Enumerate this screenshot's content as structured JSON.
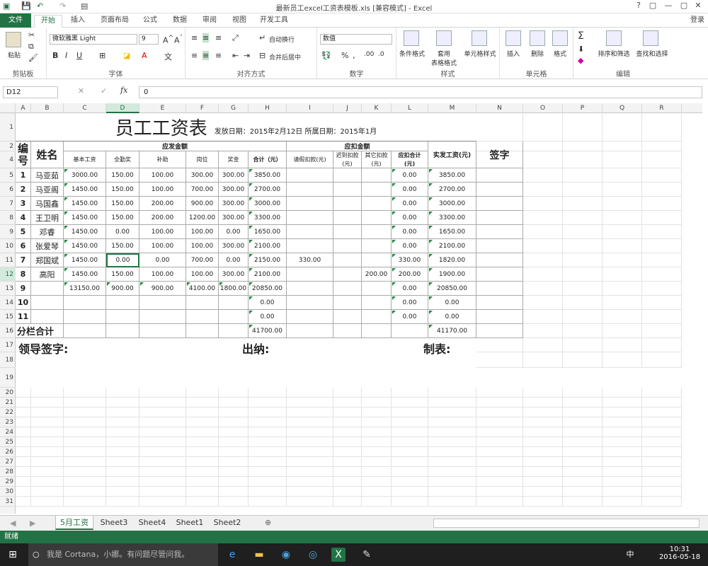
{
  "window": {
    "title": "最新员工excel工资表模板.xls  [兼容模式] - Excel",
    "controls": [
      "?",
      "▢",
      "—",
      "▢",
      "✕"
    ],
    "login": "登录"
  },
  "tabs": [
    "文件",
    "开始",
    "插入",
    "页面布局",
    "公式",
    "数据",
    "审阅",
    "视图",
    "开发工具"
  ],
  "ribbon": {
    "clipboard": {
      "paste": "粘贴",
      "label": "剪贴板"
    },
    "font": {
      "name": "微软雅黑 Light",
      "size": "9",
      "label": "字体",
      "bold": "B",
      "italic": "I",
      "underline": "U"
    },
    "align": {
      "wrap": "自动换行",
      "merge": "合并后居中",
      "label": "对齐方式"
    },
    "number": {
      "format": "数值",
      "label": "数字"
    },
    "styles": {
      "cond": "条件格式",
      "table": "套用\n表格格式",
      "cell": "单元格样式",
      "label": "样式"
    },
    "cells": {
      "insert": "插入",
      "delete": "删除",
      "format": "格式",
      "label": "单元格"
    },
    "edit": {
      "sort": "排序和筛选",
      "find": "查找和选择",
      "label": "编辑"
    }
  },
  "formula": {
    "namebox": "D12",
    "fx": "fx",
    "value": "0"
  },
  "columns": [
    "A",
    "B",
    "C",
    "D",
    "E",
    "F",
    "G",
    "H",
    "I",
    "J",
    "K",
    "L",
    "M",
    "N",
    "O",
    "P",
    "Q",
    "R"
  ],
  "rows": [
    "1",
    "2",
    "4",
    "5",
    "6",
    "7",
    "8",
    "9",
    "10",
    "11",
    "12",
    "13",
    "14",
    "15",
    "16",
    "17",
    "18",
    "19",
    "20",
    "21",
    "22",
    "23",
    "24",
    "25",
    "26",
    "27",
    "28",
    "29",
    "30",
    "31"
  ],
  "sheet": {
    "title": "员工工资表",
    "subtitle": "发放日期：2015年2月12日 所属日期：2015年1月",
    "h_num": "编号",
    "h_name": "姓名",
    "h_pay": "应发金额",
    "h_ded": "应扣金额",
    "h_net": "实发工资(元)",
    "h_sign": "签字",
    "sub": [
      "基本工资",
      "全勤奖",
      "补助",
      "岗位",
      "奖金",
      "合计（元）",
      "请假扣款(元)",
      "迟到扣款(元)",
      "其它扣款(元)",
      "应扣合计(元)"
    ],
    "data": [
      [
        "1",
        "马亚茹",
        "3000.00",
        "150.00",
        "100.00",
        "300.00",
        "300.00",
        "3850.00",
        "",
        "",
        "",
        "0.00",
        "3850.00"
      ],
      [
        "2",
        "马亚阁",
        "1450.00",
        "150.00",
        "100.00",
        "700.00",
        "300.00",
        "2700.00",
        "",
        "",
        "",
        "0.00",
        "2700.00"
      ],
      [
        "3",
        "马国鑫",
        "1450.00",
        "150.00",
        "200.00",
        "900.00",
        "300.00",
        "3000.00",
        "",
        "",
        "",
        "0.00",
        "3000.00"
      ],
      [
        "4",
        "王卫明",
        "1450.00",
        "150.00",
        "200.00",
        "1200.00",
        "300.00",
        "3300.00",
        "",
        "",
        "",
        "0.00",
        "3300.00"
      ],
      [
        "5",
        "邓睿",
        "1450.00",
        "0.00",
        "100.00",
        "100.00",
        "0.00",
        "1650.00",
        "",
        "",
        "",
        "0.00",
        "1650.00"
      ],
      [
        "6",
        "张爱琴",
        "1450.00",
        "150.00",
        "100.00",
        "100.00",
        "300.00",
        "2100.00",
        "",
        "",
        "",
        "0.00",
        "2100.00"
      ],
      [
        "7",
        "郑国斌",
        "1450.00",
        "0.00",
        "0.00",
        "700.00",
        "0.00",
        "2150.00",
        "330.00",
        "",
        "",
        "330.00",
        "1820.00"
      ],
      [
        "8",
        "高阳",
        "1450.00",
        "150.00",
        "100.00",
        "100.00",
        "300.00",
        "2100.00",
        "",
        "",
        "200.00",
        "200.00",
        "1900.00"
      ],
      [
        "9",
        "",
        "13150.00",
        "900.00",
        "900.00",
        "4100.00",
        "1800.00",
        "20850.00",
        "",
        "",
        "",
        "0.00",
        "20850.00"
      ],
      [
        "10",
        "",
        "",
        "",
        "",
        "",
        "",
        "0.00",
        "",
        "",
        "",
        "0.00",
        "0.00"
      ],
      [
        "11",
        "",
        "",
        "",
        "",
        "",
        "",
        "0.00",
        "",
        "",
        "",
        "0.00",
        "0.00"
      ]
    ],
    "subtotal_label": "分栏合计",
    "subtotal_h": "41700.00",
    "subtotal_m": "41170.00",
    "sign1": "领导签字:",
    "sign2": "出纳:",
    "sign3": "制表:"
  },
  "sheettabs": [
    "5月工资",
    "Sheet3",
    "Sheet4",
    "Sheet1",
    "Sheet2"
  ],
  "status": "就绪",
  "taskbar": {
    "cortana": "我是 Cortana，小娜。有问题尽管问我。",
    "time": "10:31",
    "date": "2016-05-18",
    "ime": "中"
  }
}
